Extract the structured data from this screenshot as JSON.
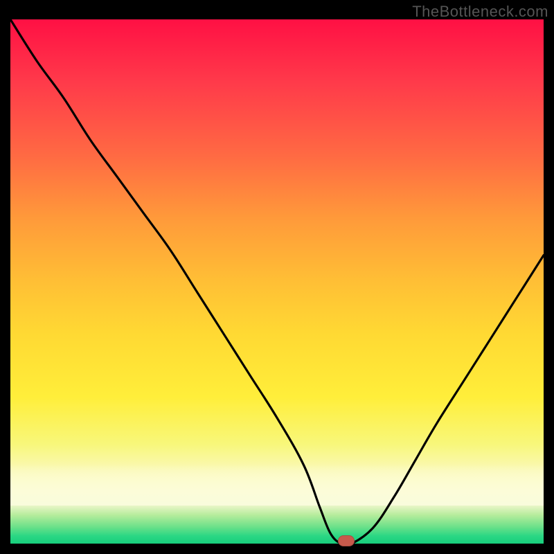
{
  "watermark": "TheBottleneck.com",
  "colors": {
    "frame": "#000000",
    "curve": "#000000",
    "marker": "#c85a4c"
  },
  "chart_data": {
    "type": "line",
    "title": "",
    "xlabel": "",
    "ylabel": "",
    "xlim": [
      0,
      100
    ],
    "ylim": [
      0,
      100
    ],
    "grid": false,
    "legend": false,
    "series": [
      {
        "name": "bottleneck-curve",
        "x": [
          0,
          5,
          10,
          15,
          20,
          25,
          30,
          35,
          40,
          45,
          50,
          55,
          58,
          60,
          62,
          64,
          68,
          72,
          76,
          80,
          85,
          90,
          95,
          100
        ],
        "y": [
          100,
          92,
          85,
          77,
          70,
          63,
          56,
          48,
          40,
          32,
          24,
          15,
          7,
          2,
          0,
          0,
          3,
          9,
          16,
          23,
          31,
          39,
          47,
          55
        ]
      }
    ],
    "annotations": [
      {
        "name": "optimum-marker",
        "x": 63,
        "y": 0
      }
    ],
    "background_gradient_stops": [
      {
        "pos": 0.0,
        "color": "#ff1044"
      },
      {
        "pos": 0.26,
        "color": "#ff6a43"
      },
      {
        "pos": 0.5,
        "color": "#ffbf35"
      },
      {
        "pos": 0.72,
        "color": "#ffee3a"
      },
      {
        "pos": 0.9,
        "color": "#fcfad6"
      },
      {
        "pos": 1.0,
        "color": "#19d27f"
      }
    ]
  }
}
